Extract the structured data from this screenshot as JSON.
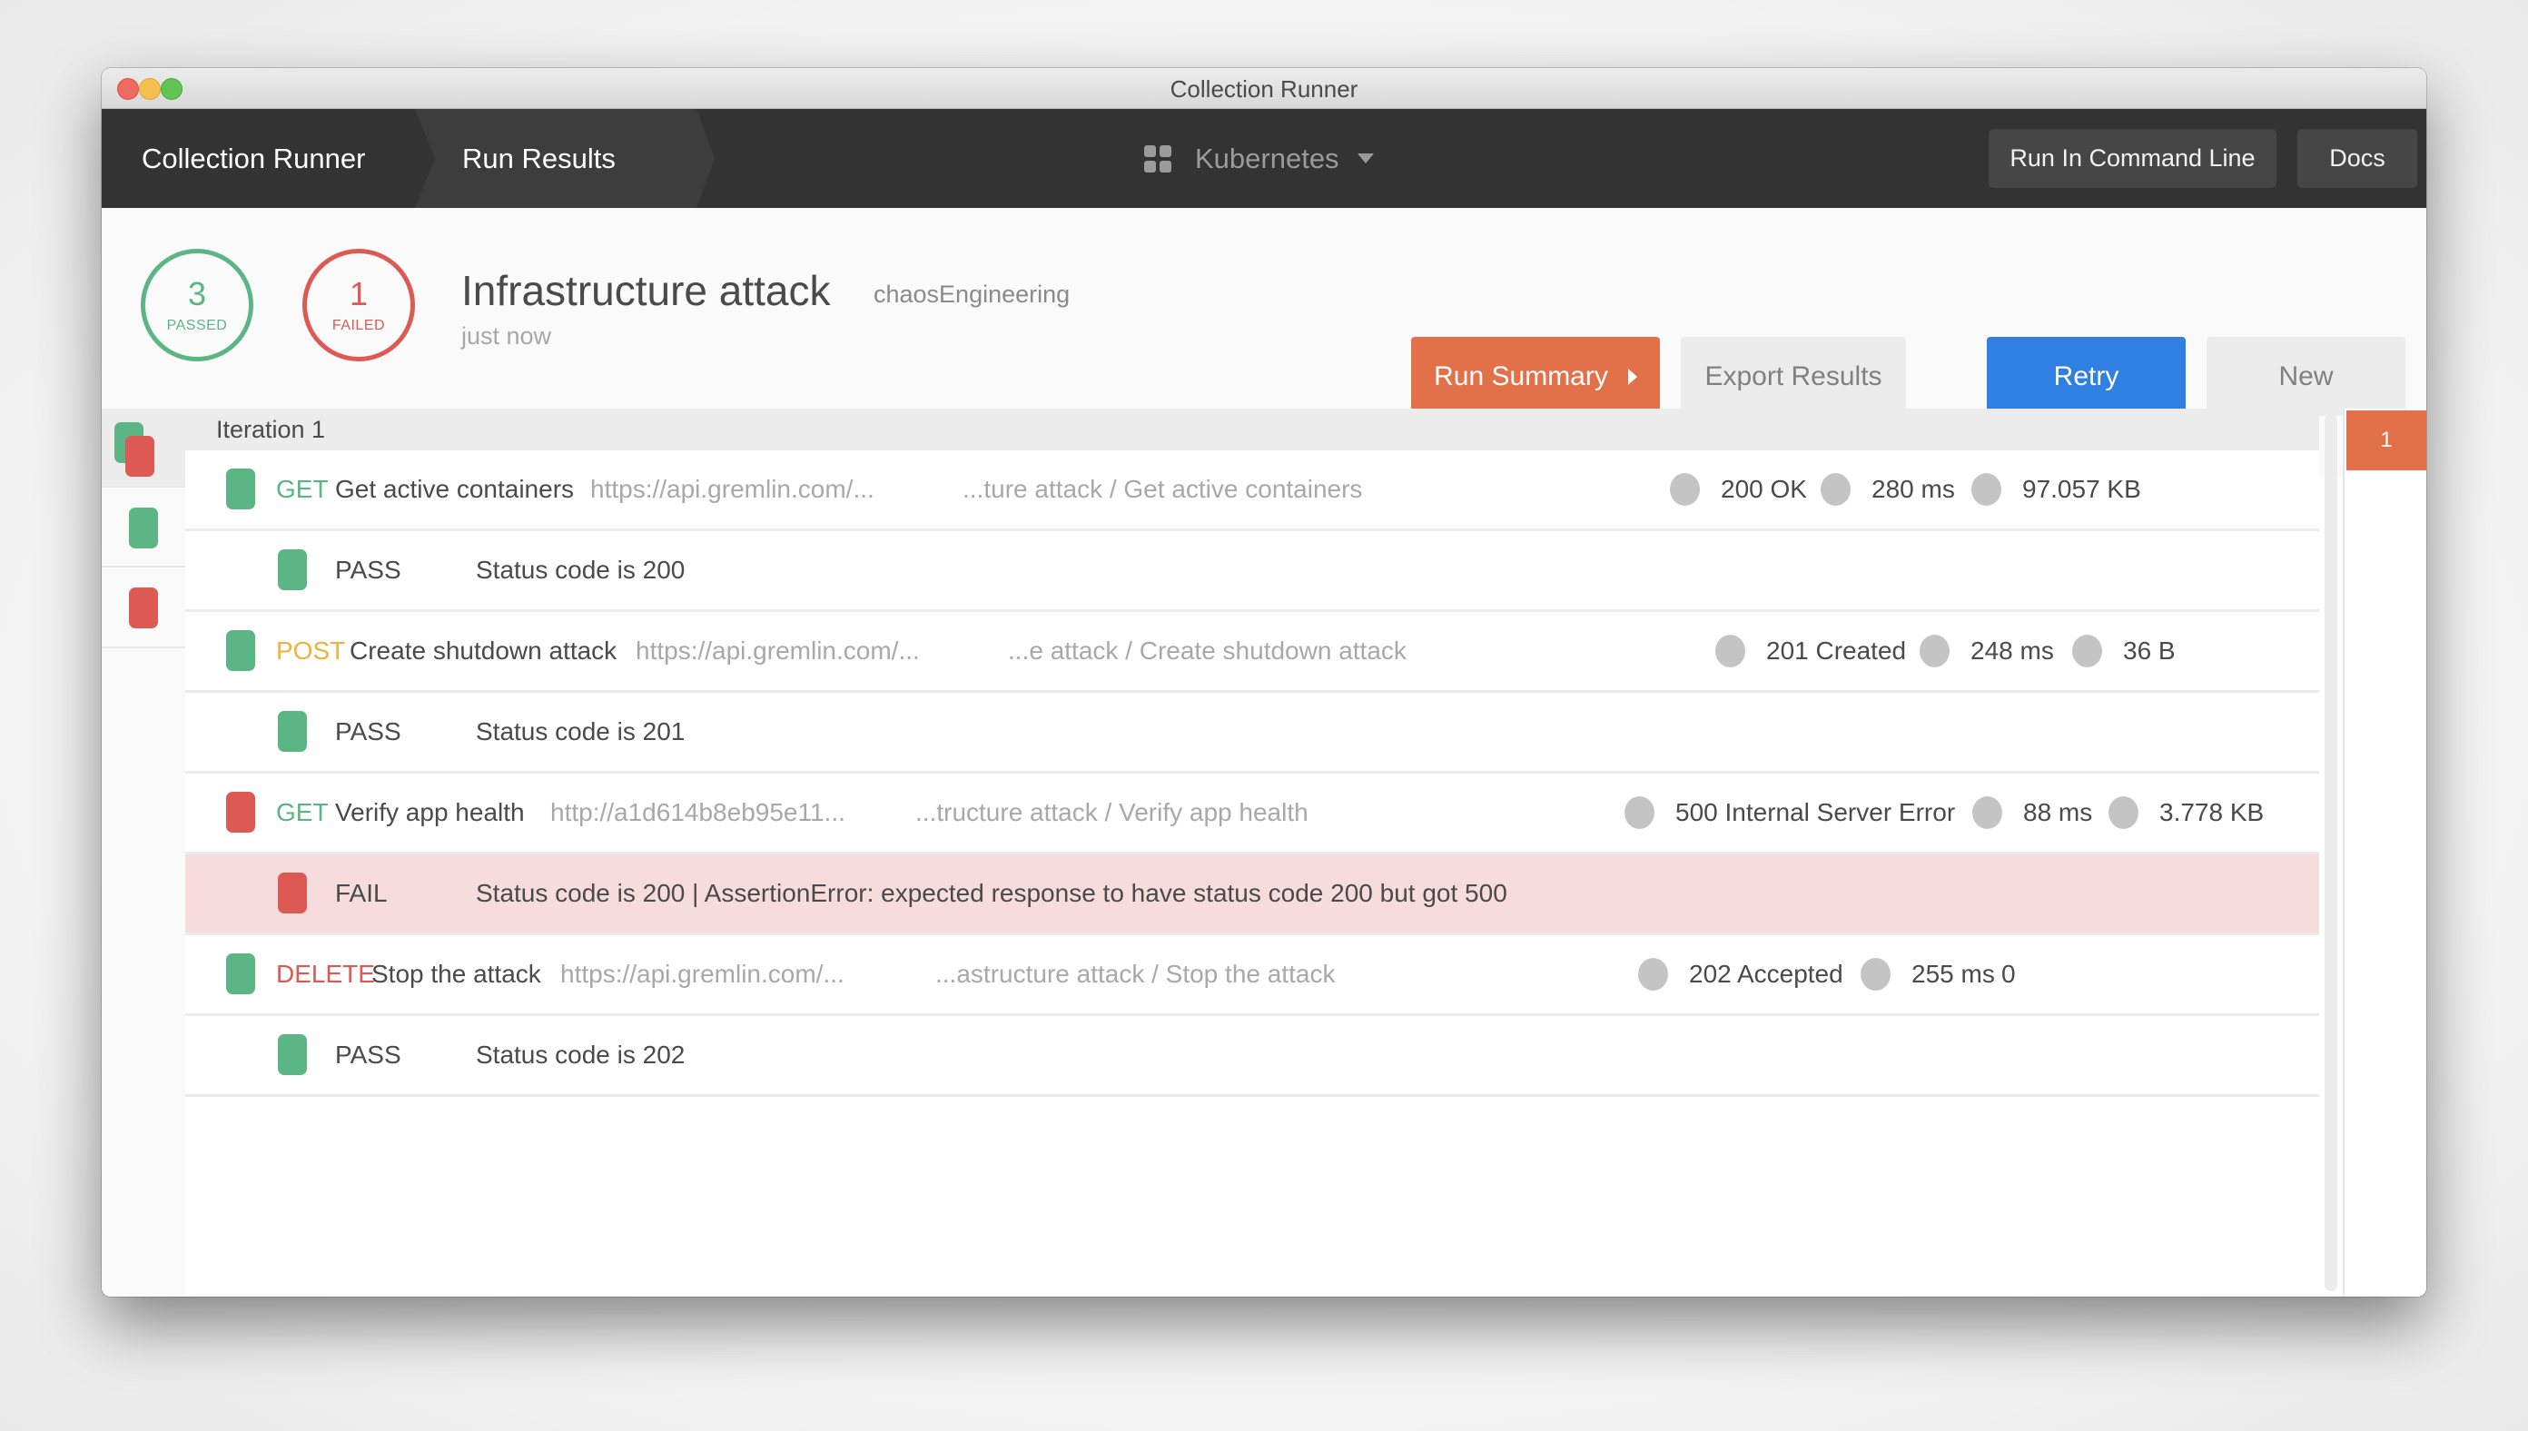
{
  "window": {
    "title": "Collection Runner"
  },
  "nav": {
    "breadcrumbs": [
      "Collection Runner",
      "Run Results"
    ],
    "workspace": "Kubernetes",
    "workspace_icon": "grid-icon",
    "run_cli_label": "Run In Command Line",
    "docs_label": "Docs"
  },
  "summary": {
    "passed_count": "3",
    "passed_label": "PASSED",
    "failed_count": "1",
    "failed_label": "FAILED",
    "run_name": "Infrastructure attack",
    "environment": "chaosEngineering",
    "time": "just now",
    "run_summary_label": "Run Summary",
    "export_label": "Export Results",
    "retry_label": "Retry",
    "new_label": "New"
  },
  "colors": {
    "pass": "#5bb585",
    "fail": "#dc5a53",
    "accent_orange": "#e2714a",
    "accent_blue": "#307fe2",
    "method_get": "#5bb585",
    "method_post": "#f0b23c",
    "method_delete": "#dc5a53"
  },
  "iterations": [
    {
      "label": "Iteration 1",
      "badge": "1"
    }
  ],
  "sidebar": [
    {
      "status": "mixed"
    },
    {
      "status": "pass"
    },
    {
      "status": "fail"
    }
  ],
  "requests": [
    {
      "status": "pass",
      "method": "GET",
      "name": "Get active containers",
      "url": "https://api.gremlin.com/...",
      "path": "...ture attack / Get active containers",
      "code": "200 OK",
      "time": "280 ms",
      "size": "97.057 KB",
      "tests": [
        {
          "result": "PASS",
          "text": "Status code is 200"
        }
      ]
    },
    {
      "status": "pass",
      "method": "POST",
      "name": "Create shutdown attack",
      "url": "https://api.gremlin.com/...",
      "path": "...e attack / Create shutdown attack",
      "code": "201 Created",
      "time": "248 ms",
      "size": "36 B",
      "tests": [
        {
          "result": "PASS",
          "text": "Status code is 201"
        }
      ]
    },
    {
      "status": "fail",
      "method": "GET",
      "name": "Verify app health",
      "url": "http://a1d614b8eb95e11...",
      "path": "...tructure attack / Verify app health",
      "code": "500 Internal Server Error",
      "time": "88 ms",
      "size": "3.778 KB",
      "tests": [
        {
          "result": "FAIL",
          "text": "Status code is 200 | AssertionError: expected response to have status code 200 but got 500"
        }
      ]
    },
    {
      "status": "pass",
      "method": "DELETE",
      "name": "Stop the attack",
      "url": "https://api.gremlin.com/...",
      "path": "...astructure attack / Stop the attack",
      "code": "202 Accepted",
      "time": "255 ms",
      "size": "0",
      "tests": [
        {
          "result": "PASS",
          "text": "Status code is 202"
        }
      ]
    }
  ]
}
